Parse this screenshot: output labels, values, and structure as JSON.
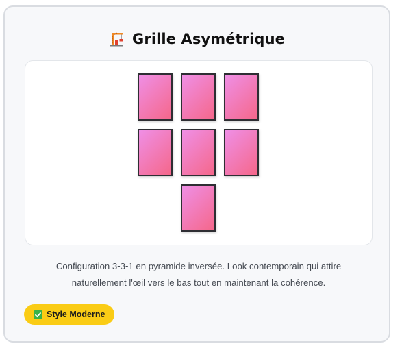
{
  "card": {
    "title": "Grille Asymétrique",
    "title_icon": "construction-crane-icon",
    "description": "Configuration 3-3-1 en pyramide inversée. Look contemporain qui attire naturellement l'œil vers le bas tout en maintenant la cohérence.",
    "badge": {
      "icon": "check-mark-icon",
      "label": "Style Moderne"
    }
  },
  "colors": {
    "tile_gradient_start": "#ef8fe6",
    "tile_gradient_end": "#f5678a",
    "tile_border": "#2e2e33",
    "badge_background": "#facc15",
    "check_green": "#3bb24a"
  }
}
